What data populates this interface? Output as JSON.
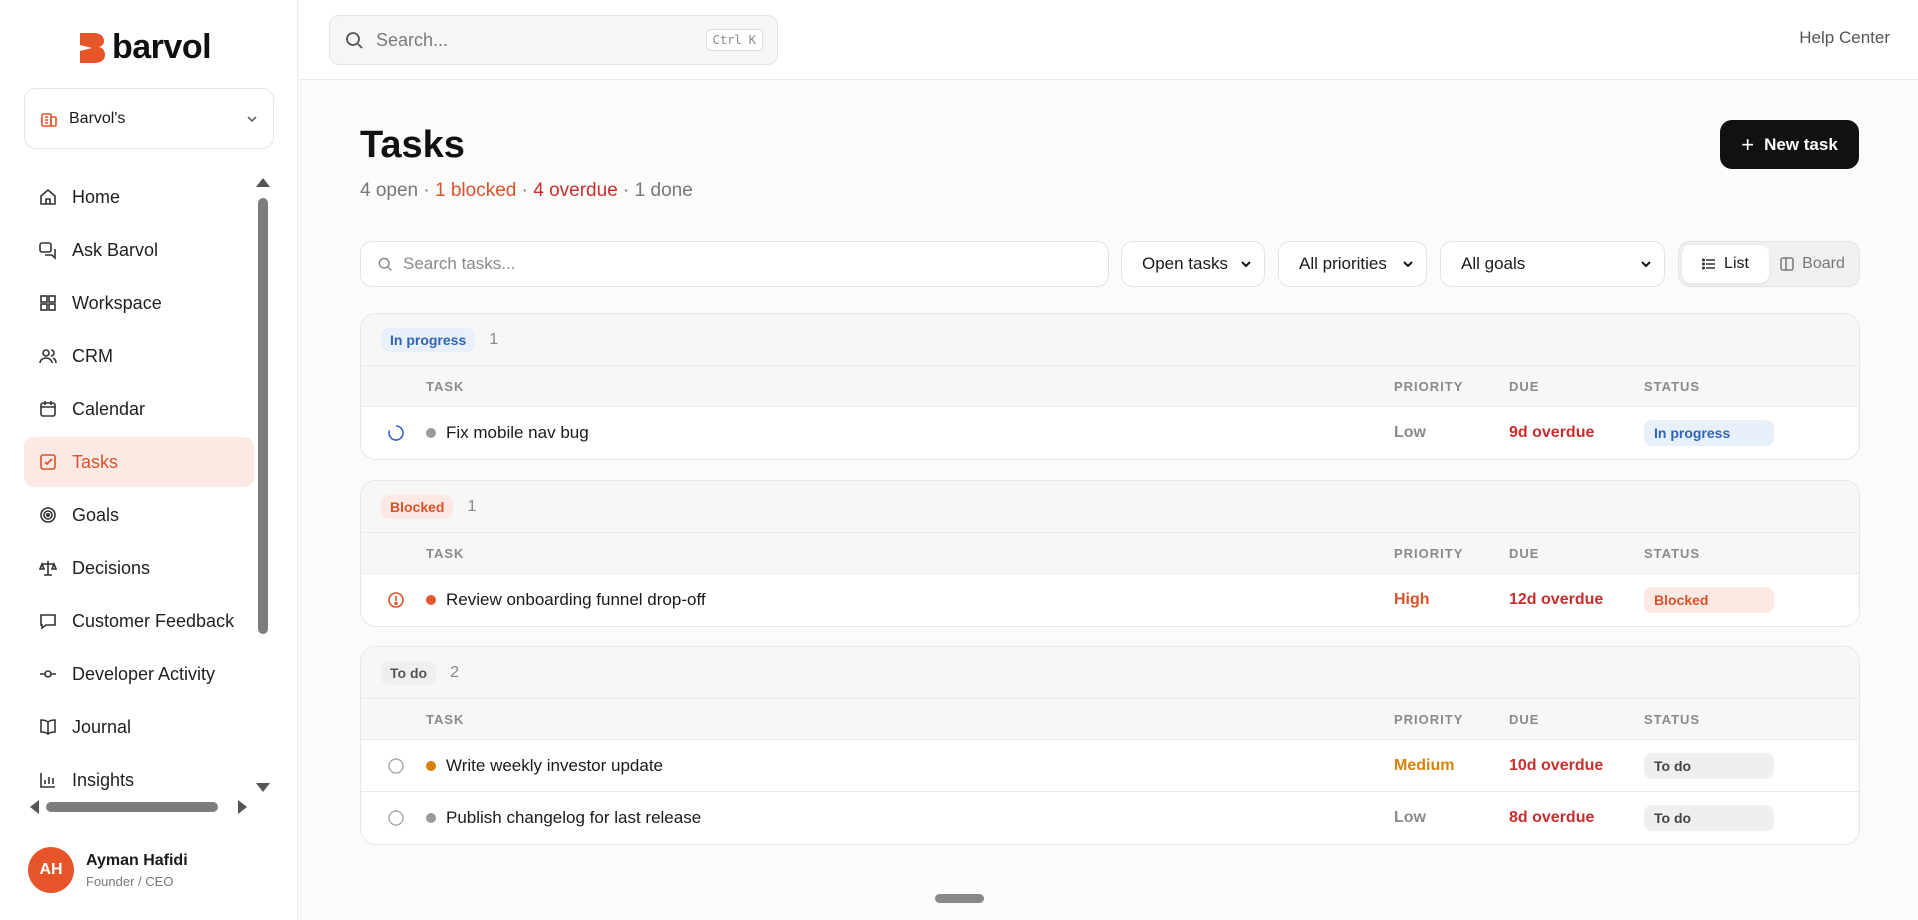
{
  "app": {
    "brand": "barvol"
  },
  "workspace": {
    "name": "Barvol's"
  },
  "sidebar": {
    "items": [
      {
        "label": "Home",
        "icon": "home-icon"
      },
      {
        "label": "Ask Barvol",
        "icon": "chat-icon"
      },
      {
        "label": "Workspace",
        "icon": "grid-icon"
      },
      {
        "label": "CRM",
        "icon": "users-icon"
      },
      {
        "label": "Calendar",
        "icon": "calendar-icon"
      },
      {
        "label": "Tasks",
        "icon": "checkbox-icon",
        "active": true
      },
      {
        "label": "Goals",
        "icon": "target-icon"
      },
      {
        "label": "Decisions",
        "icon": "scale-icon"
      },
      {
        "label": "Customer Feedback",
        "icon": "message-icon"
      },
      {
        "label": "Developer Activity",
        "icon": "commit-icon"
      },
      {
        "label": "Journal",
        "icon": "book-icon"
      },
      {
        "label": "Insights",
        "icon": "bar-chart-icon"
      }
    ]
  },
  "user": {
    "initials": "AH",
    "name": "Ayman Hafidi",
    "role": "Founder / CEO"
  },
  "topbar": {
    "search_placeholder": "Search...",
    "shortcut": "Ctrl K",
    "help": "Help Center"
  },
  "page": {
    "title": "Tasks",
    "summary": {
      "open": "4 open",
      "blocked": "1 blocked",
      "overdue": "4 overdue",
      "done": "1 done",
      "sep": " · "
    },
    "new_task": "New task"
  },
  "filters": {
    "search_placeholder": "Search tasks...",
    "status": "Open tasks",
    "priority": "All priorities",
    "goal": "All goals",
    "view_list": "List",
    "view_board": "Board"
  },
  "columns": {
    "task": "TASK",
    "priority": "PRIORITY",
    "due": "DUE",
    "status": "STATUS"
  },
  "colors": {
    "accent": "#e8542a",
    "blocked": "#d9532a",
    "overdue": "#c92e2e",
    "in_progress": "#2f65b8",
    "medium": "#d9800b",
    "low": "#8a8a8a"
  },
  "groups": [
    {
      "label": "In progress",
      "count": "1",
      "tasks": [
        {
          "title": "Fix mobile nav bug",
          "priority": "Low",
          "due": "9d overdue",
          "status": "In progress"
        }
      ]
    },
    {
      "label": "Blocked",
      "count": "1",
      "tasks": [
        {
          "title": "Review onboarding funnel drop-off",
          "priority": "High",
          "due": "12d overdue",
          "status": "Blocked"
        }
      ]
    },
    {
      "label": "To do",
      "count": "2",
      "tasks": [
        {
          "title": "Write weekly investor update",
          "priority": "Medium",
          "due": "10d overdue",
          "status": "To do"
        },
        {
          "title": "Publish changelog for last release",
          "priority": "Low",
          "due": "8d overdue",
          "status": "To do"
        }
      ]
    }
  ]
}
